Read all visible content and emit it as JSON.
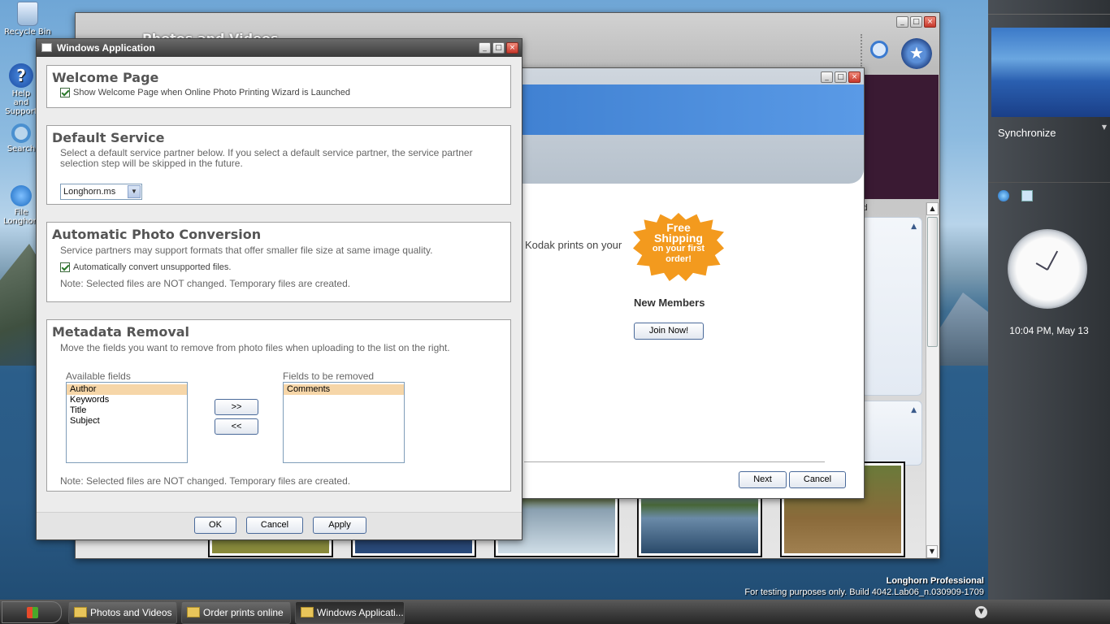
{
  "desktop": {
    "icons": [
      {
        "label": "Recycle Bin"
      },
      {
        "label": "Help and Support"
      },
      {
        "label": "Search"
      },
      {
        "label": "File Longhorn"
      }
    ],
    "watermark": {
      "edition": "Longhorn Professional",
      "build": "For testing purposes only. Build 4042.Lab06_n.030909-1709"
    }
  },
  "photos_window": {
    "title": "Photos and Videos",
    "tab_partial": "d"
  },
  "order_window": {
    "promo_text": "Kodak prints on your",
    "badge_lines": [
      "Free",
      "Shipping",
      "on your first",
      "order!"
    ],
    "new_members_label": "New Members",
    "join_label": "Join Now!",
    "next_label": "Next",
    "cancel_label": "Cancel"
  },
  "dialog": {
    "title": "Windows Application",
    "welcome": {
      "heading": "Welcome Page",
      "checkbox_label": "Show Welcome Page when Online Photo Printing Wizard is Launched",
      "checked": true
    },
    "default_service": {
      "heading": "Default Service",
      "description": "Select a default service partner below. If you select a default service partner, the service partner selection step will be skipped in the future.",
      "selected": "Longhorn.ms"
    },
    "conversion": {
      "heading": "Automatic Photo Conversion",
      "description": "Service partners may support formats that offer smaller file size at same image quality.",
      "checkbox_label": "Automatically convert unsupported files.",
      "checked": true,
      "note": "Note: Selected files are NOT changed. Temporary files are created."
    },
    "metadata": {
      "heading": "Metadata Removal",
      "description": "Move the fields you want to remove from photo files when uploading to the list on the right.",
      "available_label": "Available fields",
      "available": [
        "Author",
        "Keywords",
        "Title",
        "Subject"
      ],
      "removed_label": "Fields to be removed",
      "removed": [
        "Comments"
      ],
      "add_label": ">>",
      "remove_label": "<<",
      "note": "Note: Selected files are NOT changed. Temporary files are created."
    },
    "buttons": {
      "ok": "OK",
      "cancel": "Cancel",
      "apply": "Apply"
    }
  },
  "sidebar": {
    "synchronize": "Synchronize",
    "clock_text": "10:04 PM, May 13"
  },
  "taskbar": {
    "items": [
      {
        "label": "Photos and Videos"
      },
      {
        "label": "Order prints online"
      },
      {
        "label": "Windows Applicati..."
      }
    ]
  }
}
